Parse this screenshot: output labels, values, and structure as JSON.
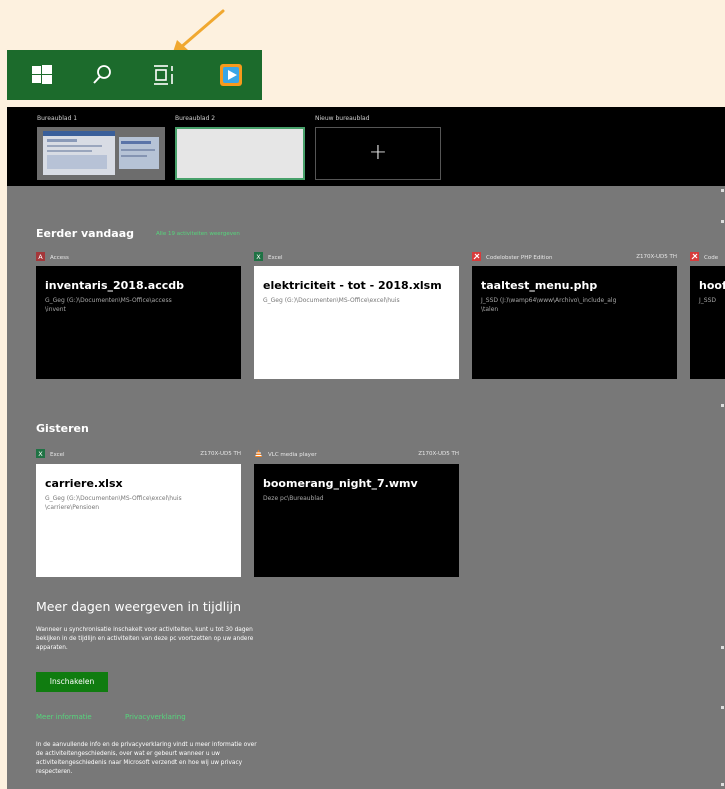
{
  "taskbar": {
    "icons": [
      "windows-icon",
      "search-icon",
      "task-view-icon",
      "vlc-taskbar-icon"
    ],
    "annotation_color": "#f0a830"
  },
  "virtual_desktops": [
    {
      "label": "Bureaublad 1"
    },
    {
      "label": "Bureaublad 2",
      "selected": true
    },
    {
      "label": "Nieuw bureaublad",
      "icon": "plus-icon"
    }
  ],
  "sections": {
    "today": {
      "title": "Eerder vandaag",
      "link": "Alle 19 activiteiten weergeven",
      "cards": [
        {
          "app": "Access",
          "app_icon": "access-icon",
          "device": "",
          "title": "inventaris_2018.accdb",
          "path": "G_Geg (G:)\\Documenten\\MS-Office\\access\n\\invent",
          "theme": "dark"
        },
        {
          "app": "Excel",
          "app_icon": "excel-icon",
          "device": "",
          "title": "elektriciteit - tot - 2018.xlsm",
          "path": "G_Geg (G:)\\Documenten\\MS-Office\\excel\\huis",
          "theme": "light"
        },
        {
          "app": "Codelobster PHP Edition",
          "app_icon": "codelobster-icon",
          "device": "Z170X-UD5 TH",
          "title": "taaltest_menu.php",
          "path": "J_SSD (J:)\\wamp64\\www\\Archivo\\_include_alg\n\\talen",
          "theme": "dark"
        },
        {
          "app": "Code",
          "app_icon": "codelobster-icon",
          "device": "",
          "title": "hoof",
          "path": "J_SSD",
          "theme": "dark"
        }
      ]
    },
    "yesterday": {
      "title": "Gisteren",
      "cards": [
        {
          "app": "Excel",
          "app_icon": "excel-icon",
          "device": "Z170X-UD5 TH",
          "title": "carriere.xlsx",
          "path": "G_Geg (G:)\\Documenten\\MS-Office\\excel\\huis\n\\carriere\\Pensioen",
          "theme": "light"
        },
        {
          "app": "VLC media player",
          "app_icon": "vlc-icon",
          "device": "Z170X-UD5 TH",
          "title": "boomerang_night_7.wmv",
          "path": "Deze pc\\Bureaublad",
          "theme": "dark"
        }
      ]
    }
  },
  "more_days": {
    "title": "Meer dagen weergeven in tijdlijn",
    "description": "Wanneer u synchronisatie inschakelt voor activiteiten, kunt u tot 30 dagen bekijken in de tijdlijn en activiteiten van deze pc voortzetten op uw andere apparaten.",
    "button": "Inschakelen",
    "link_more": "Meer informatie",
    "link_privacy": "Privacyverklaring",
    "footer": "In de aanvullende info en de privacyverklaring vindt u meer informatie over de activiteitengeschiedenis, over wat er gebeurt wanneer u uw activiteitengeschiedenis naar Microsoft verzendt en hoe wij uw privacy respecteren."
  },
  "colors": {
    "accent_green": "#107c10",
    "link_green": "#56d67c",
    "taskbar": "#1c6b2c",
    "panel": "#787878"
  }
}
